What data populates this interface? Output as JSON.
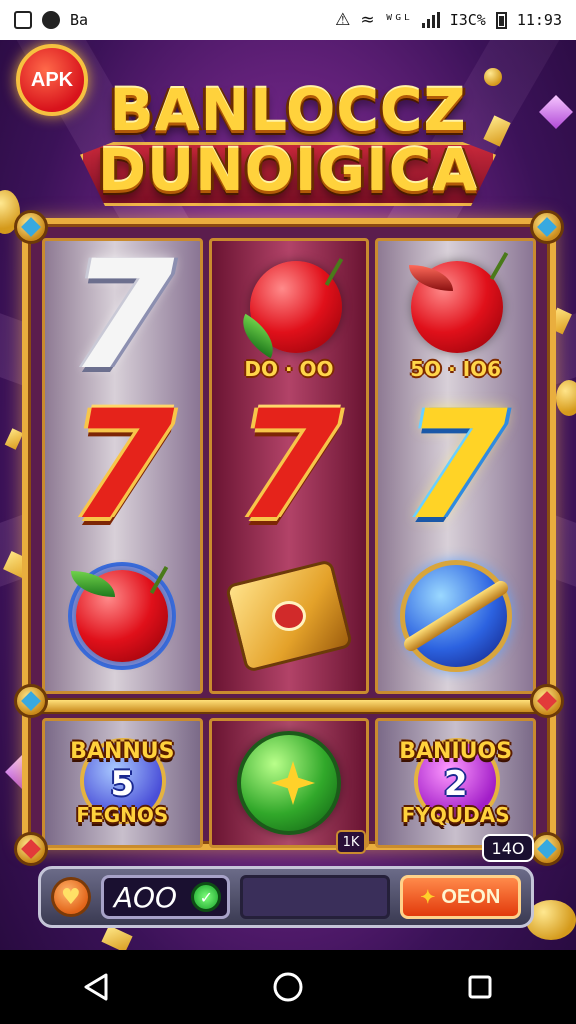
{
  "status_bar": {
    "left_text": "Ba",
    "right_text_a": "ᵂᴳᴸ",
    "battery_text": "Ι3C%",
    "time": "11:93"
  },
  "badge": {
    "label": "APK"
  },
  "title": {
    "line1": "BANLOCCZ",
    "line2": "DUNOIGICA"
  },
  "reels": {
    "row1": {
      "col1_symbol": "7",
      "col2_label": "DO · OO",
      "col3_label": "5O · IO6"
    },
    "row2": {
      "col1_symbol": "7",
      "col2_symbol": "7",
      "col3_symbol": "7"
    }
  },
  "bonus": {
    "left": {
      "top": "BANNUS",
      "number": "5",
      "bottom": "FEGNOS"
    },
    "right": {
      "top": "BANIUOS",
      "number": "2",
      "bottom": "FYQUDAS"
    }
  },
  "small_tag": "1K",
  "bet_value": "14O",
  "controls": {
    "credit": "AOO",
    "spin_label": "OEON",
    "heart_glyph": "♥",
    "check_glyph": "✓",
    "spin_glyph": "✦"
  },
  "colors": {
    "background": "#7a2a8e",
    "frame_gold": "#e9ae3e",
    "title_gold": "#ffd23c",
    "spin_orange": "#e23a0c"
  }
}
